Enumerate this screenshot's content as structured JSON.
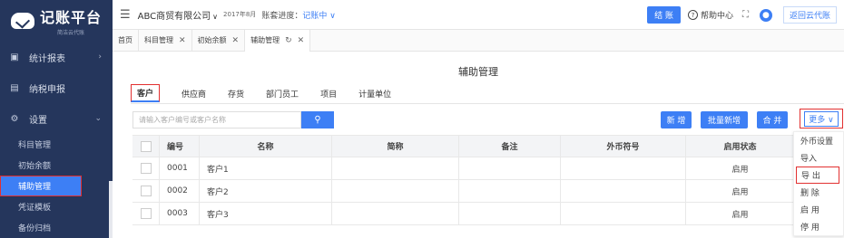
{
  "app": {
    "logo_title": "记账平台",
    "logo_sub": "简洁云代账"
  },
  "sidebar": {
    "items": [
      {
        "label": "统计报表",
        "icon": "chart-icon",
        "glyph": "▣",
        "arrow": "›"
      },
      {
        "label": "纳税申报",
        "icon": "tax-icon",
        "glyph": "▤"
      },
      {
        "label": "设置",
        "icon": "gear-icon",
        "glyph": "⚙",
        "arrow": "⌄"
      }
    ],
    "sub_items": [
      {
        "label": "科目管理"
      },
      {
        "label": "初始余额"
      },
      {
        "label": "辅助管理",
        "active": true
      },
      {
        "label": "凭证模板"
      },
      {
        "label": "备份归档"
      }
    ]
  },
  "topbar": {
    "menu_glyph": "☰",
    "company": "ABC商贸有限公司",
    "company_caret": "∨",
    "period": "2017年8月",
    "progress_label": "账套进度：",
    "progress_value": "记账中 ∨",
    "settle_label": "结 账",
    "help_label": "帮助中心",
    "expand_glyph": "⛶",
    "back_label": "返回云代账"
  },
  "tabs": [
    {
      "label": "首页",
      "closable": false
    },
    {
      "label": "科目管理",
      "closable": true
    },
    {
      "label": "初始余额",
      "closable": true
    },
    {
      "label": "辅助管理",
      "closable": true,
      "active": true
    }
  ],
  "main": {
    "title": "辅助管理",
    "type_tabs": [
      "客户",
      "供应商",
      "存货",
      "部门员工",
      "项目",
      "计量单位"
    ],
    "search_placeholder": "请输入客户编号或客户名称",
    "search_glyph": "🔍",
    "buttons": {
      "add": "新 增",
      "batch_add": "批量新增",
      "merge": "合 并",
      "more": "更多 ∨"
    }
  },
  "table": {
    "columns": [
      "编号",
      "名称",
      "简称",
      "备注",
      "外币符号",
      "启用状态"
    ],
    "rows": [
      {
        "code": "0001",
        "name": "客户1",
        "short": "",
        "note": "",
        "currency": "",
        "status": "启用"
      },
      {
        "code": "0002",
        "name": "客户2",
        "short": "",
        "note": "",
        "currency": "",
        "status": "启用"
      },
      {
        "code": "0003",
        "name": "客户3",
        "short": "",
        "note": "",
        "currency": "",
        "status": "启用"
      }
    ]
  },
  "dropdown": {
    "items": [
      "外币设置",
      "导入",
      "导 出",
      "删 除",
      "启 用",
      "停 用"
    ]
  }
}
